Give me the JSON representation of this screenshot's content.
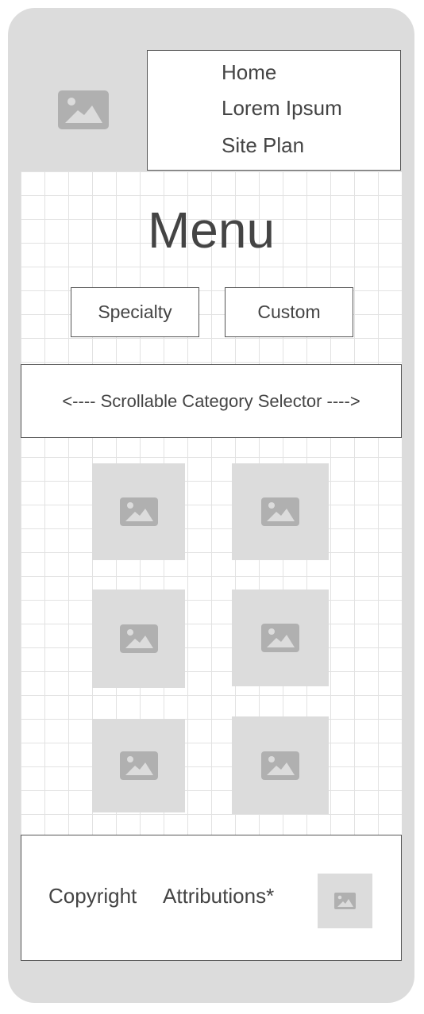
{
  "nav": {
    "items": [
      {
        "label": "Home"
      },
      {
        "label": "Lorem Ipsum"
      },
      {
        "label": "Site Plan"
      }
    ]
  },
  "page": {
    "title": "Menu"
  },
  "menu_types": {
    "specialty_label": "Specialty",
    "custom_label": "Custom"
  },
  "category_selector": {
    "label": "<---- Scrollable Category Selector ---->"
  },
  "footer": {
    "copyright_label": "Copyright",
    "attributions_label": "Attributions*"
  },
  "icons": {
    "placeholder": "image-placeholder-icon"
  },
  "colors": {
    "frame": "#dcdcdc",
    "placeholder_icon": "#b0b0b0",
    "text": "#444444",
    "border": "#555555"
  }
}
